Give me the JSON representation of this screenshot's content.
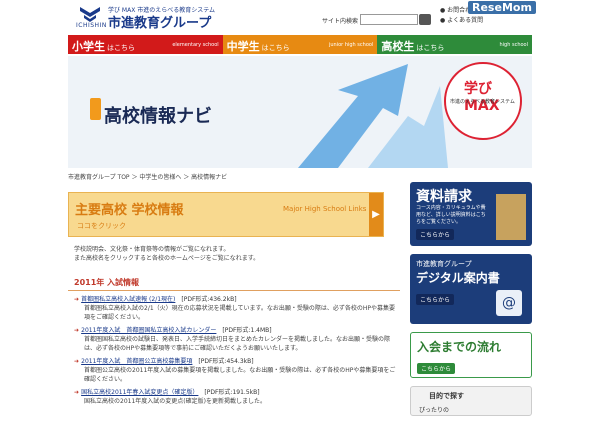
{
  "header": {
    "logo_en": "ICHISHIN",
    "tag": "学び MAX 市進のえらべる教育システム",
    "brand": "市進教育グループ",
    "search_label": "サイト内検索",
    "links": [
      "お問合わせ",
      "よくある質問"
    ],
    "watermark": "ReseMom"
  },
  "nav": {
    "tabs": [
      {
        "label": "小学生",
        "suffix": "はこちら",
        "en": "elementary school"
      },
      {
        "label": "中学生",
        "suffix": "はこちら",
        "en": "junior high school"
      },
      {
        "label": "高校生",
        "suffix": "はこちら",
        "en": "high school"
      }
    ]
  },
  "hero": {
    "title": "高校情報ナビ",
    "badge_big": "学び MAX",
    "badge_small": "市進のえらべる教育システム"
  },
  "breadcrumb": "市進教育グループ TOP ＞ 中学生の皆様へ ＞ 高校情報ナビ",
  "banner": {
    "title": "主要高校 学校情報",
    "sub": "ココをクリック",
    "en": "Major High School Links"
  },
  "intro": [
    "学校説明会、文化祭・体育祭等の情報がご覧になれます。",
    "また高校名をクリックすると各校のホームページをご覧になれます。"
  ],
  "section_title": "2011年 入試情報",
  "entries": [
    {
      "name": "首都圏私立高校入試速報 (2/1現在)",
      "pdf": "[PDF形式:436.2kB]",
      "desc": "首都圏私立高校入試の2/1（火）現在の応募状況を掲載しています。なお出願・受験の際は、必ず各校のHPや募集要項をご確認ください。"
    },
    {
      "name": "2011年度入試　首都圏国私立高校入試カレンダー",
      "pdf": "[PDF形式:1.4MB]",
      "desc": "首都圏国私立高校の試験日、発表日、入学手続締切日をまとめたカレンダーを掲載しました。なお出願・受験の際は、必ず各校のHPや募集要項等で事前にご確認いただくようお願いいたします。"
    },
    {
      "name": "2011年度入試　首都圏公立高校募集要項",
      "pdf": "[PDF形式:454.3kB]",
      "desc": "首都圏公立高校の2011年度入試の募集要項を掲載しました。なお出願・受験の際は、必ず各校のHPや募集要項をご確認ください。"
    },
    {
      "name": "国私立高校2011年春入試変更点（確定版）",
      "pdf": "[PDF形式:191.5kB]",
      "desc": "国私立高校の2011年度入試の変更点(確定版)を更新掲載しました。"
    }
  ],
  "sidebar": {
    "request": {
      "title": "資料請求",
      "sub": "コース内容・カリキュラムや費用など、詳しい説明資料はこちらをご覧ください。",
      "btn": "こちらから"
    },
    "digital": {
      "line1": "市進教育グループ",
      "line2": "デジタル案内書",
      "btn": "こちらから"
    },
    "flow": {
      "title": "入会までの流れ",
      "btn": "こちらから"
    },
    "purpose": {
      "title": "目的で探す",
      "sub": "ぴったりの"
    }
  },
  "colors": {
    "elem": "#d21a1a",
    "jr": "#e78a12",
    "hs": "#2e8b3a",
    "navy": "#1c3d7a"
  }
}
